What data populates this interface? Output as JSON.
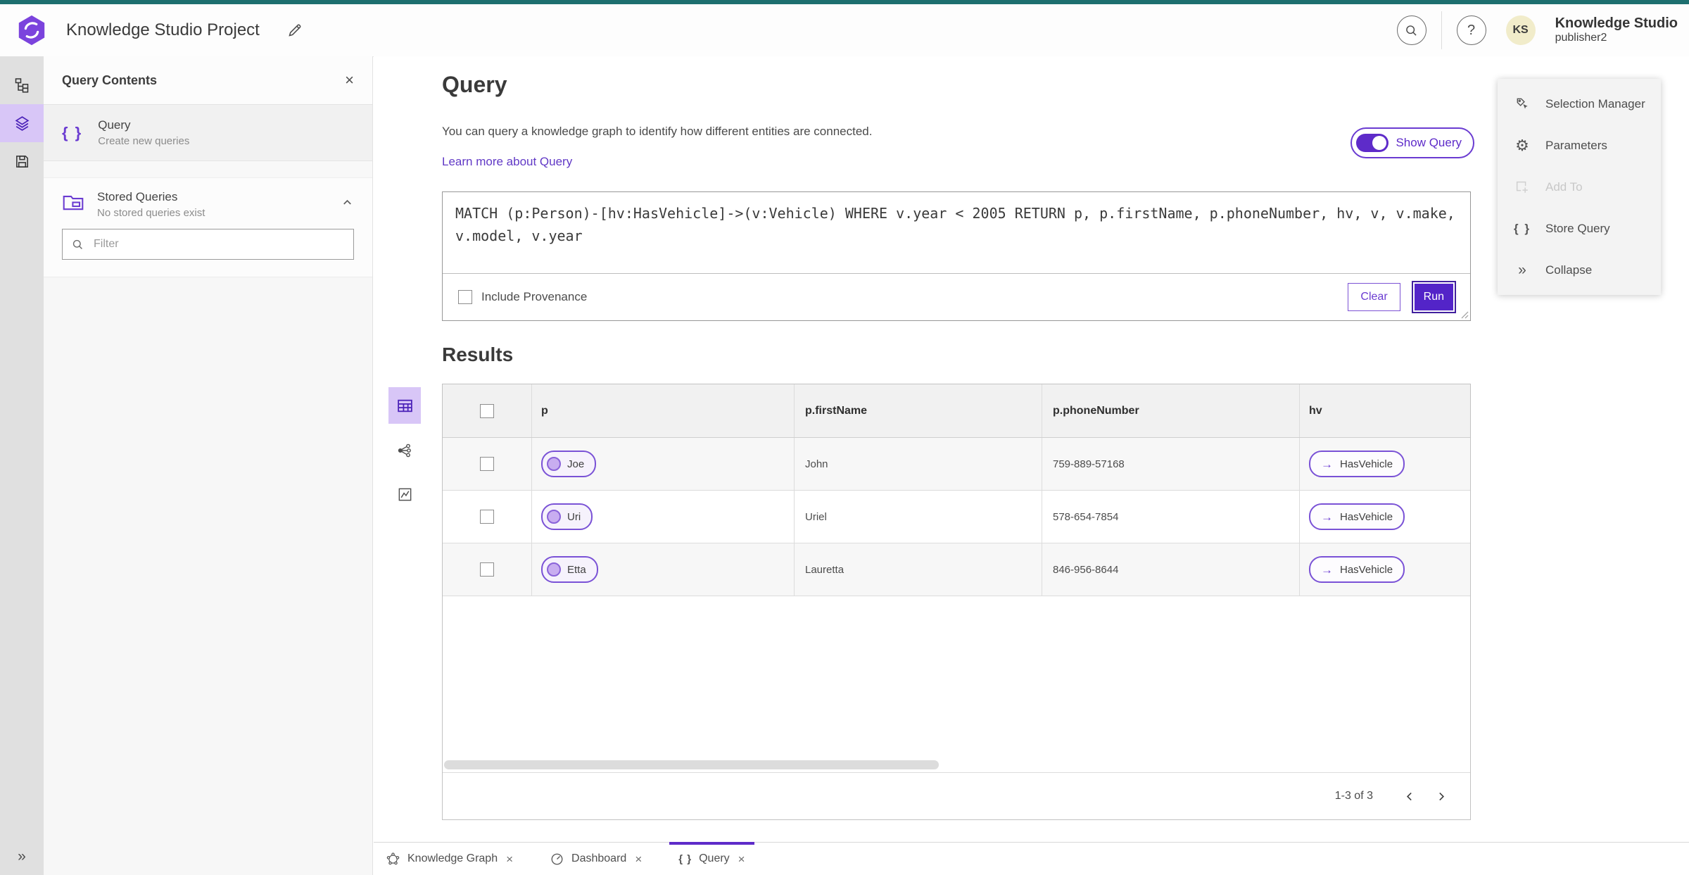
{
  "colors": {
    "accent": "#5e2bc9",
    "accent_light": "#d8c6f7",
    "teal_strip": "#1d6f6f",
    "avatar_bg": "#f1ecca"
  },
  "header": {
    "app_title": "Knowledge Studio Project",
    "avatar_initials": "KS",
    "user_name": "Knowledge Studio",
    "user_role": "publisher2",
    "help_glyph": "?"
  },
  "left_panel": {
    "title": "Query Contents",
    "query_item": {
      "title": "Query",
      "subtitle": "Create new queries"
    },
    "stored_queries": {
      "title": "Stored Queries",
      "subtitle": "No stored queries exist"
    },
    "filter": {
      "placeholder": "Filter"
    }
  },
  "query_section": {
    "title": "Query",
    "description": "You can query a knowledge graph to identify how different entities are connected.",
    "learn_more": "Learn more about Query",
    "show_query_label": "Show Query",
    "query_text": "MATCH (p:Person)-[hv:HasVehicle]->(v:Vehicle) WHERE v.year < 2005 RETURN p, p.firstName, p.phoneNumber, hv, v, v.make, v.model, v.year",
    "include_provenance_label": "Include Provenance",
    "clear_label": "Clear",
    "run_label": "Run"
  },
  "results": {
    "title": "Results",
    "columns": [
      "p",
      "p.firstName",
      "p.phoneNumber",
      "hv"
    ],
    "rows": [
      {
        "p": "Joe",
        "firstName": "John",
        "phone": "759-889-57168",
        "hv": "HasVehicle"
      },
      {
        "p": "Uri",
        "firstName": "Uriel",
        "phone": "578-654-7854",
        "hv": "HasVehicle"
      },
      {
        "p": "Etta",
        "firstName": "Lauretta",
        "phone": "846-956-8644",
        "hv": "HasVehicle"
      }
    ],
    "pagination": {
      "label": "1-3 of 3"
    }
  },
  "right_panel": {
    "items": [
      {
        "label": "Selection Manager"
      },
      {
        "label": "Parameters"
      },
      {
        "label": "Add To"
      },
      {
        "label": "Store Query"
      },
      {
        "label": "Collapse"
      }
    ]
  },
  "bottom_tabs": [
    {
      "label": "Knowledge Graph"
    },
    {
      "label": "Dashboard"
    },
    {
      "label": "Query"
    }
  ]
}
